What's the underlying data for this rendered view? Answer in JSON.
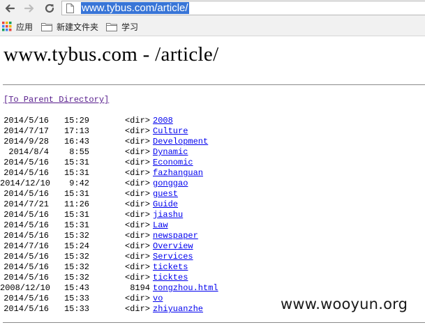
{
  "browser": {
    "url": "www.tybus.com/article/",
    "bookmarks": [
      {
        "label": "应用",
        "icon": "apps-grid-icon"
      },
      {
        "label": "新建文件夹",
        "icon": "folder-icon"
      },
      {
        "label": "学习",
        "icon": "folder-icon"
      }
    ]
  },
  "page": {
    "title": "www.tybus.com - /article/",
    "parent_link": "[To Parent Directory]",
    "entries": [
      {
        "date": "2014/5/16",
        "time": "15:29",
        "size": "<dir>",
        "name": "2008"
      },
      {
        "date": "2014/7/17",
        "time": "17:13",
        "size": "<dir>",
        "name": "Culture"
      },
      {
        "date": "2014/9/28",
        "time": "16:43",
        "size": "<dir>",
        "name": "Development"
      },
      {
        "date": "2014/8/4",
        "time": "8:55",
        "size": "<dir>",
        "name": "Dynamic"
      },
      {
        "date": "2014/5/16",
        "time": "15:31",
        "size": "<dir>",
        "name": "Economic"
      },
      {
        "date": "2014/5/16",
        "time": "15:31",
        "size": "<dir>",
        "name": "fazhanguan"
      },
      {
        "date": "2014/12/10",
        "time": "9:42",
        "size": "<dir>",
        "name": "gonggao"
      },
      {
        "date": "2014/5/16",
        "time": "15:31",
        "size": "<dir>",
        "name": "guest"
      },
      {
        "date": "2014/7/21",
        "time": "11:26",
        "size": "<dir>",
        "name": "Guide"
      },
      {
        "date": "2014/5/16",
        "time": "15:31",
        "size": "<dir>",
        "name": "jiashu"
      },
      {
        "date": "2014/5/16",
        "time": "15:31",
        "size": "<dir>",
        "name": "Law"
      },
      {
        "date": "2014/5/16",
        "time": "15:32",
        "size": "<dir>",
        "name": "newspaper"
      },
      {
        "date": "2014/7/16",
        "time": "15:24",
        "size": "<dir>",
        "name": "Overview"
      },
      {
        "date": "2014/5/16",
        "time": "15:32",
        "size": "<dir>",
        "name": "Services"
      },
      {
        "date": "2014/5/16",
        "time": "15:32",
        "size": "<dir>",
        "name": "tickets"
      },
      {
        "date": "2014/5/16",
        "time": "15:32",
        "size": "<dir>",
        "name": "ticktes"
      },
      {
        "date": "2008/12/10",
        "time": "15:43",
        "size": "8194",
        "name": "tongzhou.html"
      },
      {
        "date": "2014/5/16",
        "time": "15:33",
        "size": "<dir>",
        "name": "vo"
      },
      {
        "date": "2014/5/16",
        "time": "15:33",
        "size": "<dir>",
        "name": "zhiyuanzhe"
      }
    ]
  },
  "watermark": "www.wooyun.org"
}
